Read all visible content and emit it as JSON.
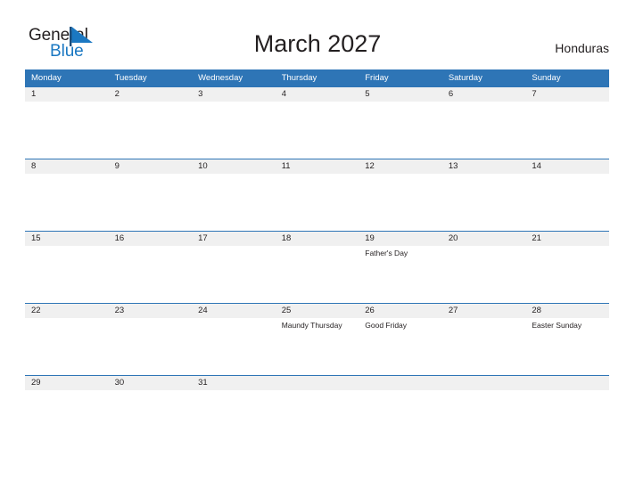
{
  "branding": {
    "name_part1": "General",
    "name_part2": "Blue",
    "mark_icon": "triangle-flag-icon",
    "accent_color": "#1b78c2"
  },
  "header": {
    "title": "March 2027",
    "region": "Honduras"
  },
  "colors": {
    "header_blue": "#2e75b6",
    "number_band": "#f0f0f0",
    "text": "#231f20",
    "page_background": "#ffffff"
  },
  "calendar": {
    "month": "March",
    "year": "2027",
    "weekday_headers": [
      "Monday",
      "Tuesday",
      "Wednesday",
      "Thursday",
      "Friday",
      "Saturday",
      "Sunday"
    ],
    "weeks": [
      {
        "days": [
          {
            "number": "1",
            "events": []
          },
          {
            "number": "2",
            "events": []
          },
          {
            "number": "3",
            "events": []
          },
          {
            "number": "4",
            "events": []
          },
          {
            "number": "5",
            "events": []
          },
          {
            "number": "6",
            "events": []
          },
          {
            "number": "7",
            "events": []
          }
        ]
      },
      {
        "days": [
          {
            "number": "8",
            "events": []
          },
          {
            "number": "9",
            "events": []
          },
          {
            "number": "10",
            "events": []
          },
          {
            "number": "11",
            "events": []
          },
          {
            "number": "12",
            "events": []
          },
          {
            "number": "13",
            "events": []
          },
          {
            "number": "14",
            "events": []
          }
        ]
      },
      {
        "days": [
          {
            "number": "15",
            "events": []
          },
          {
            "number": "16",
            "events": []
          },
          {
            "number": "17",
            "events": []
          },
          {
            "number": "18",
            "events": []
          },
          {
            "number": "19",
            "events": [
              "Father's Day"
            ]
          },
          {
            "number": "20",
            "events": []
          },
          {
            "number": "21",
            "events": []
          }
        ]
      },
      {
        "days": [
          {
            "number": "22",
            "events": []
          },
          {
            "number": "23",
            "events": []
          },
          {
            "number": "24",
            "events": []
          },
          {
            "number": "25",
            "events": [
              "Maundy Thursday"
            ]
          },
          {
            "number": "26",
            "events": [
              "Good Friday"
            ]
          },
          {
            "number": "27",
            "events": []
          },
          {
            "number": "28",
            "events": [
              "Easter Sunday"
            ]
          }
        ]
      },
      {
        "days": [
          {
            "number": "29",
            "events": []
          },
          {
            "number": "30",
            "events": []
          },
          {
            "number": "31",
            "events": []
          },
          {
            "number": "",
            "events": []
          },
          {
            "number": "",
            "events": []
          },
          {
            "number": "",
            "events": []
          },
          {
            "number": "",
            "events": []
          }
        ]
      }
    ]
  }
}
